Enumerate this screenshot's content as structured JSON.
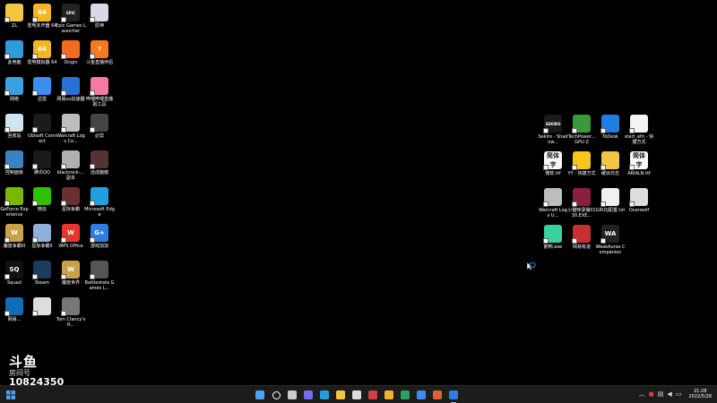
{
  "desktop": {
    "left_icons": [
      {
        "label": "ZL",
        "icon": "folder-icon",
        "color": "#f4c443",
        "text": ""
      },
      {
        "label": "雷电多开器 64",
        "icon": "ldplayer-multi-icon",
        "color": "#f3b81f",
        "text": "64"
      },
      {
        "label": "Epic Games Launcher",
        "icon": "epic-games-icon",
        "color": "#222222",
        "text": "EPIC"
      },
      {
        "label": "原神",
        "icon": "genshin-icon",
        "color": "#d8d8e8",
        "text": ""
      },
      {
        "label": "此电脑",
        "icon": "this-pc-icon",
        "color": "#2f9bd8",
        "text": ""
      },
      {
        "label": "雷电模拟器 64",
        "icon": "ldplayer-icon",
        "color": "#f3b81f",
        "text": "64"
      },
      {
        "label": "Origin",
        "icon": "origin-icon",
        "color": "#f26b22",
        "text": ""
      },
      {
        "label": "斗鱼直播伴侣",
        "icon": "douyu-icon",
        "color": "#f47b20",
        "text": "?"
      },
      {
        "label": "网络",
        "icon": "network-icon",
        "color": "#3aa0e0",
        "text": ""
      },
      {
        "label": "迅雷",
        "icon": "thunder-icon",
        "color": "#3c8ff0",
        "text": ""
      },
      {
        "label": "网易uu加速器",
        "icon": "uu-accelerator-icon",
        "color": "#2a6fd8",
        "text": ""
      },
      {
        "label": "哔哩哔哩直播姬工具",
        "icon": "bilibili-live-icon",
        "color": "#f57aa5",
        "text": ""
      },
      {
        "label": "回收站",
        "icon": "recycle-bin-icon",
        "color": "#cfe3f0",
        "text": ""
      },
      {
        "label": "Ubisoft Connect",
        "icon": "ubisoft-icon",
        "color": "#1b1b1b",
        "text": ""
      },
      {
        "label": "Warcraft Logs Co...",
        "icon": "warcraft-logs-icon",
        "color": "#bdbdbd",
        "text": ""
      },
      {
        "label": "必剪",
        "icon": "bijian-icon",
        "color": "#444444",
        "text": ""
      },
      {
        "label": "控制面板",
        "icon": "control-panel-icon",
        "color": "#3b82c4",
        "text": ""
      },
      {
        "label": "腾讯QQ",
        "icon": "qq-icon",
        "color": "#1a1a1a",
        "text": ""
      },
      {
        "label": "blackrock-...副本",
        "icon": "blackrock-icon",
        "color": "#b0b0b0",
        "text": ""
      },
      {
        "label": "远成脑瘤",
        "icon": "game-icon",
        "color": "#553333",
        "text": ""
      },
      {
        "label": "GeForce Experience",
        "icon": "geforce-icon",
        "color": "#76b900",
        "text": ""
      },
      {
        "label": "微信",
        "icon": "wechat-icon",
        "color": "#2dc100",
        "text": ""
      },
      {
        "label": "星际争霸",
        "icon": "starcraft-icon",
        "color": "#6a3030",
        "text": ""
      },
      {
        "label": "Microsoft Edge",
        "icon": "edge-icon",
        "color": "#1fa0e0",
        "text": ""
      },
      {
        "label": "魔兽争霸III",
        "icon": "warcraft3-icon",
        "color": "#c9a14a",
        "text": "W"
      },
      {
        "label": "星际争霸II",
        "icon": "starcraft2-icon",
        "color": "#8fb0d8",
        "text": ""
      },
      {
        "label": "WPS Office",
        "icon": "wps-icon",
        "color": "#e8352e",
        "text": "W"
      },
      {
        "label": "游戏加加",
        "icon": "youxijiajia-icon",
        "color": "#2f7de0",
        "text": "G+"
      },
      {
        "label": "Squad",
        "icon": "squad-icon",
        "color": "#111111",
        "text": "SQ"
      },
      {
        "label": "Steam",
        "icon": "steam-icon",
        "color": "#1b3b5f",
        "text": ""
      },
      {
        "label": "魔兽世界",
        "icon": "wow-icon",
        "color": "#c9a14a",
        "text": "W"
      },
      {
        "label": "Battlestate Games L...",
        "icon": "battlestate-icon",
        "color": "#555555",
        "text": ""
      },
      {
        "label": "网易...",
        "icon": "netease-icon",
        "color": "#0f6db8",
        "text": ""
      },
      {
        "label": "",
        "icon": "controller-icon",
        "color": "#dddddd",
        "text": ""
      },
      {
        "label": "Tom Clancy's R...",
        "icon": "rainbow-six-icon",
        "color": "#777777",
        "text": ""
      }
    ],
    "right_icons": [
      {
        "label": "Sekiro - Shadow...",
        "icon": "sekiro-icon",
        "color": "#1a1a1a",
        "text": "SEKIRO"
      },
      {
        "label": "TechPower... GPU-Z",
        "icon": "gpuz-icon",
        "color": "#3a9a3a",
        "text": ""
      },
      {
        "label": "ToDesk",
        "icon": "todesk-icon",
        "color": "#1e7fe0",
        "text": ""
      },
      {
        "label": "start_eth - 快捷方式",
        "icon": "shortcut-file-icon",
        "color": "#f4f4f4",
        "text": ""
      },
      {
        "label": "微软.ttf",
        "icon": "font-file-icon",
        "color": "#f8f8f8",
        "text": "简体字"
      },
      {
        "label": "YY - 快捷方式",
        "icon": "yy-icon",
        "color": "#f7c61a",
        "text": ""
      },
      {
        "label": "缓派日志",
        "icon": "folder-icon",
        "color": "#f4c443",
        "text": ""
      },
      {
        "label": "ARIALN.ttf",
        "icon": "font-file-icon",
        "color": "#f8f8f8",
        "text": "简体字"
      },
      {
        "label": "Warcraft Logs U...",
        "icon": "warcraft-logs-icon",
        "color": "#bdbdbd",
        "text": ""
      },
      {
        "label": "小猫咪录播0130.EXE...",
        "icon": "recorder-icon",
        "color": "#8a2040",
        "text": ""
      },
      {
        "label": "GIRDJ配置.txt",
        "icon": "text-file-icon",
        "color": "#f0f0f0",
        "text": ""
      },
      {
        "label": "Overwolf",
        "icon": "overwolf-icon",
        "color": "#dddddd",
        "text": ""
      },
      {
        "label": "鹅鸭.exe",
        "icon": "butterfly-icon",
        "color": "#3ad0a0",
        "text": ""
      },
      {
        "label": "网易有道",
        "icon": "youdao-icon",
        "color": "#c53030",
        "text": ""
      },
      {
        "label": "WeakAuras Companion",
        "icon": "weakauras-icon",
        "color": "#222222",
        "text": "WA"
      }
    ]
  },
  "watermark": {
    "logo": "斗鱼",
    "sub": "房间号",
    "room_id": "10824350"
  },
  "taskbar": {
    "apps": [
      {
        "name": "start-button",
        "icon": "windows-icon",
        "color": "#4aa3f0",
        "active": false
      },
      {
        "name": "search-button",
        "icon": "search-icon",
        "color": "#ffffff",
        "active": false
      },
      {
        "name": "task-view-button",
        "icon": "task-view-icon",
        "color": "#cccccc",
        "active": false
      },
      {
        "name": "chat-button",
        "icon": "chat-icon",
        "color": "#7a6cf0",
        "active": false
      },
      {
        "name": "edge-taskbar",
        "icon": "edge-icon",
        "color": "#1fa0e0",
        "active": false
      },
      {
        "name": "explorer-taskbar",
        "icon": "folder-icon",
        "color": "#f4c443",
        "active": false
      },
      {
        "name": "store-taskbar",
        "icon": "store-icon",
        "color": "#dddddd",
        "active": false
      },
      {
        "name": "app-taskbar-1",
        "icon": "app-icon",
        "color": "#d04040",
        "active": false
      },
      {
        "name": "app-taskbar-2",
        "icon": "app-icon",
        "color": "#f0b030",
        "active": false
      },
      {
        "name": "app-taskbar-3",
        "icon": "app-icon",
        "color": "#30a060",
        "active": false
      },
      {
        "name": "qq-taskbar",
        "icon": "qq-icon",
        "color": "#3c8ff0",
        "active": false
      },
      {
        "name": "app-taskbar-4",
        "icon": "app-icon",
        "color": "#e06030",
        "active": false
      },
      {
        "name": "app-taskbar-5",
        "icon": "app-icon",
        "color": "#2f7de0",
        "active": true
      }
    ],
    "clock_time": "21:28",
    "clock_date": "2022/5/28"
  }
}
